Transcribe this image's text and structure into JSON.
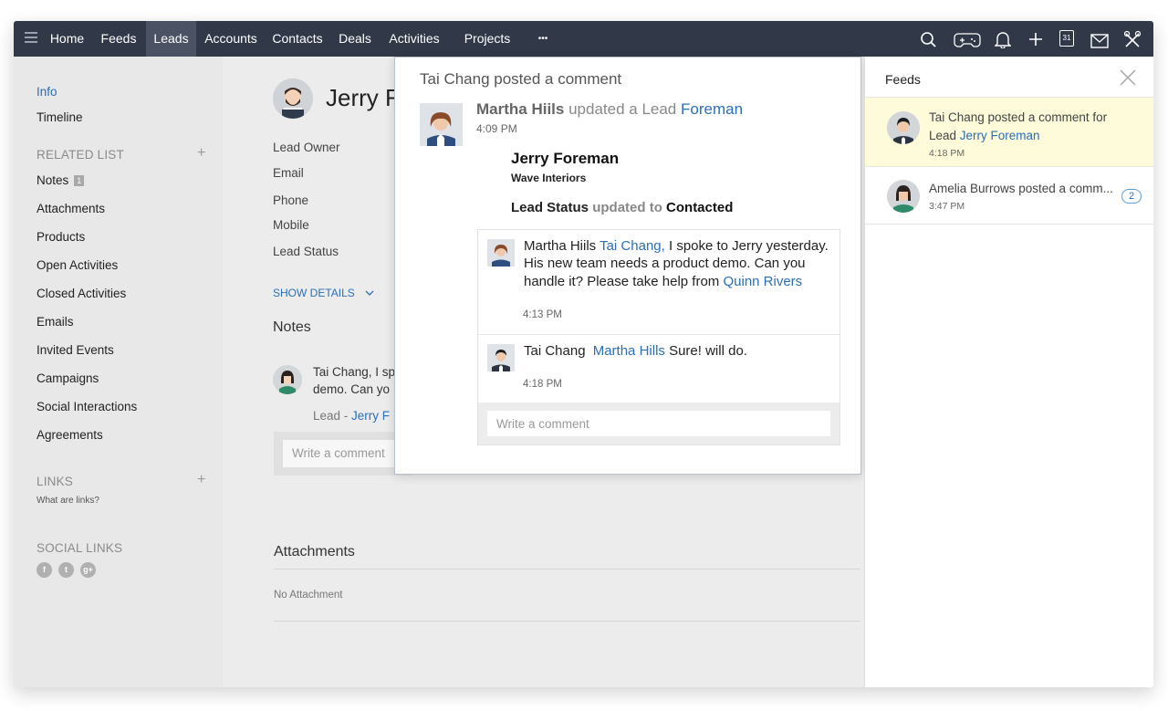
{
  "nav": {
    "items": [
      "Home",
      "Feeds",
      "Leads",
      "Accounts",
      "Contacts",
      "Deals",
      "Activities",
      "Projects"
    ],
    "more": "•••",
    "active": "Leads",
    "icons": [
      "search-icon",
      "gamepad-icon",
      "bell-icon",
      "plus-icon",
      "calendar-icon",
      "mail-icon",
      "tools-icon"
    ],
    "calendar_day": "31"
  },
  "sidebar": {
    "info": "Info",
    "timeline": "Timeline",
    "related_list": "RELATED LIST",
    "items": [
      {
        "label": "Notes",
        "badge": "1"
      },
      {
        "label": "Attachments"
      },
      {
        "label": "Products"
      },
      {
        "label": "Open Activities"
      },
      {
        "label": "Closed Activities"
      },
      {
        "label": "Emails"
      },
      {
        "label": "Invited Events"
      },
      {
        "label": "Campaigns"
      },
      {
        "label": "Social Interactions"
      },
      {
        "label": "Agreements"
      }
    ],
    "links_head": "LINKS",
    "links_help": "What are links?",
    "social_links_head": "SOCIAL LINKS",
    "social_icons": [
      "facebook-icon",
      "twitter-icon",
      "google-plus-icon"
    ]
  },
  "main": {
    "lead_name": "Jerry F",
    "fields": [
      "Lead Owner",
      "Email",
      "Phone",
      "Mobile",
      "Lead Status"
    ],
    "show_details": "SHOW DETAILS",
    "notes_head": "Notes",
    "note_line1": "Tai Chang, I sp",
    "note_line2": "demo. Can yo",
    "note_lead_prefix": "Lead - ",
    "note_lead_link": "Jerry F",
    "write_comment": "Write a comment",
    "attachments_head": "Attachments",
    "no_attachment": "No Attachment"
  },
  "popup": {
    "title": "Tai Chang posted a comment",
    "actor": "Martha Hiils",
    "action": "updated a Lead",
    "lead_link": "Foreman",
    "time": "4:09 PM",
    "lead_name": "Jerry Foreman",
    "company": "Wave Interiors",
    "status_label": "Lead Status",
    "status_verb": "updated to",
    "status_value": "Contacted",
    "comments": [
      {
        "author": "Martha Hiils",
        "mention": "Tai Chang,",
        "text1": " I spoke to Jerry yesterday.",
        "text2": "His new team needs a product demo. Can you",
        "text3": "handle it? Please take help from",
        "mention2": "Quinn Rivers",
        "time": "4:13 PM"
      },
      {
        "author": "Tai Chang",
        "mention": "Martha Hills",
        "text": "Sure! will do.",
        "time": "4:18 PM"
      }
    ],
    "write_placeholder": "Write a comment"
  },
  "feeds": {
    "title": "Feeds",
    "items": [
      {
        "text": "Tai Chang posted a comment for",
        "prefix": "Lead ",
        "link": "Jerry Foreman",
        "time": "4:18 PM"
      },
      {
        "text": "Amelia Burrows posted a comm...",
        "time": "3:47 PM",
        "count": "2"
      }
    ]
  },
  "colors": {
    "nav_bg": "#313949",
    "link_blue": "#2a6fb7",
    "highlight_yellow": "#fdfbd9"
  }
}
